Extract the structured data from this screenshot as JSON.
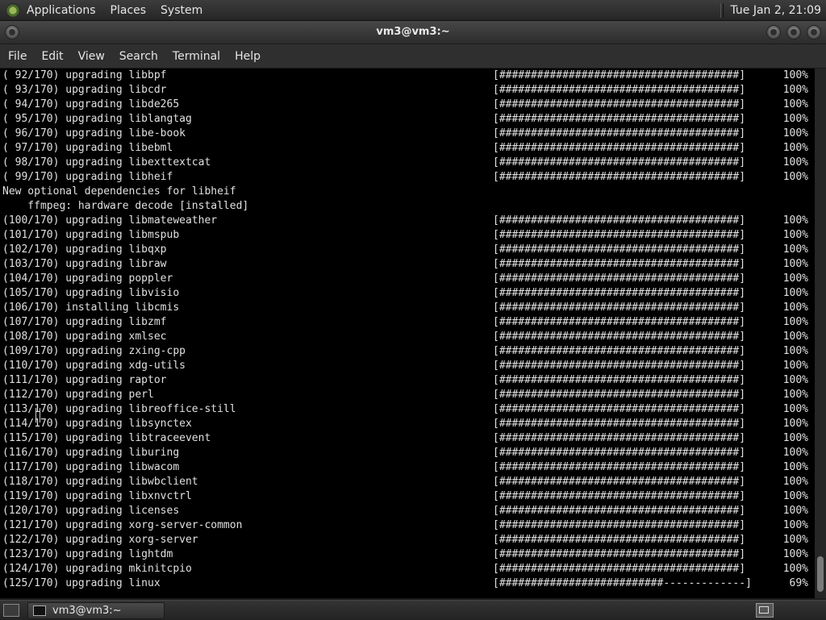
{
  "top_panel": {
    "menus": [
      "Applications",
      "Places",
      "System"
    ],
    "clock": "Tue Jan  2, 21:09"
  },
  "window": {
    "title": "vm3@vm3:~"
  },
  "menubar": [
    "File",
    "Edit",
    "View",
    "Search",
    "Terminal",
    "Help"
  ],
  "terminal": {
    "lines": [
      {
        "text": "( 92/170) upgrading libbpf",
        "bar": "[######################################]",
        "pct": "100%"
      },
      {
        "text": "( 93/170) upgrading libcdr",
        "bar": "[######################################]",
        "pct": "100%"
      },
      {
        "text": "( 94/170) upgrading libde265",
        "bar": "[######################################]",
        "pct": "100%"
      },
      {
        "text": "( 95/170) upgrading liblangtag",
        "bar": "[######################################]",
        "pct": "100%"
      },
      {
        "text": "( 96/170) upgrading libe-book",
        "bar": "[######################################]",
        "pct": "100%"
      },
      {
        "text": "( 97/170) upgrading libebml",
        "bar": "[######################################]",
        "pct": "100%"
      },
      {
        "text": "( 98/170) upgrading libexttextcat",
        "bar": "[######################################]",
        "pct": "100%"
      },
      {
        "text": "( 99/170) upgrading libheif",
        "bar": "[######################################]",
        "pct": "100%"
      },
      {
        "text": "New optional dependencies for libheif",
        "bar": "",
        "pct": ""
      },
      {
        "text": "    ffmpeg: hardware decode [installed]",
        "bar": "",
        "pct": ""
      },
      {
        "text": "(100/170) upgrading libmateweather",
        "bar": "[######################################]",
        "pct": "100%"
      },
      {
        "text": "(101/170) upgrading libmspub",
        "bar": "[######################################]",
        "pct": "100%"
      },
      {
        "text": "(102/170) upgrading libqxp",
        "bar": "[######################################]",
        "pct": "100%"
      },
      {
        "text": "(103/170) upgrading libraw",
        "bar": "[######################################]",
        "pct": "100%"
      },
      {
        "text": "(104/170) upgrading poppler",
        "bar": "[######################################]",
        "pct": "100%"
      },
      {
        "text": "(105/170) upgrading libvisio",
        "bar": "[######################################]",
        "pct": "100%"
      },
      {
        "text": "(106/170) installing libcmis",
        "bar": "[######################################]",
        "pct": "100%"
      },
      {
        "text": "(107/170) upgrading libzmf",
        "bar": "[######################################]",
        "pct": "100%"
      },
      {
        "text": "(108/170) upgrading xmlsec",
        "bar": "[######################################]",
        "pct": "100%"
      },
      {
        "text": "(109/170) upgrading zxing-cpp",
        "bar": "[######################################]",
        "pct": "100%"
      },
      {
        "text": "(110/170) upgrading xdg-utils",
        "bar": "[######################################]",
        "pct": "100%"
      },
      {
        "text": "(111/170) upgrading raptor",
        "bar": "[######################################]",
        "pct": "100%"
      },
      {
        "text": "(112/170) upgrading perl",
        "bar": "[######################################]",
        "pct": "100%"
      },
      {
        "text": "(113/170) upgrading libreoffice-still",
        "bar": "[######################################]",
        "pct": "100%"
      },
      {
        "text": "(114/170) upgrading libsynctex",
        "bar": "[######################################]",
        "pct": "100%"
      },
      {
        "text": "(115/170) upgrading libtraceevent",
        "bar": "[######################################]",
        "pct": "100%"
      },
      {
        "text": "(116/170) upgrading liburing",
        "bar": "[######################################]",
        "pct": "100%"
      },
      {
        "text": "(117/170) upgrading libwacom",
        "bar": "[######################################]",
        "pct": "100%"
      },
      {
        "text": "(118/170) upgrading libwbclient",
        "bar": "[######################################]",
        "pct": "100%"
      },
      {
        "text": "(119/170) upgrading libxnvctrl",
        "bar": "[######################################]",
        "pct": "100%"
      },
      {
        "text": "(120/170) upgrading licenses",
        "bar": "[######################################]",
        "pct": "100%"
      },
      {
        "text": "(121/170) upgrading xorg-server-common",
        "bar": "[######################################]",
        "pct": "100%"
      },
      {
        "text": "(122/170) upgrading xorg-server",
        "bar": "[######################################]",
        "pct": "100%"
      },
      {
        "text": "(123/170) upgrading lightdm",
        "bar": "[######################################]",
        "pct": "100%"
      },
      {
        "text": "(124/170) upgrading mkinitcpio",
        "bar": "[######################################]",
        "pct": "100%"
      },
      {
        "text": "(125/170) upgrading linux",
        "bar": "[##########################-------------]",
        "pct": "69%"
      }
    ]
  },
  "taskbar": {
    "task_label": "vm3@vm3:~"
  }
}
